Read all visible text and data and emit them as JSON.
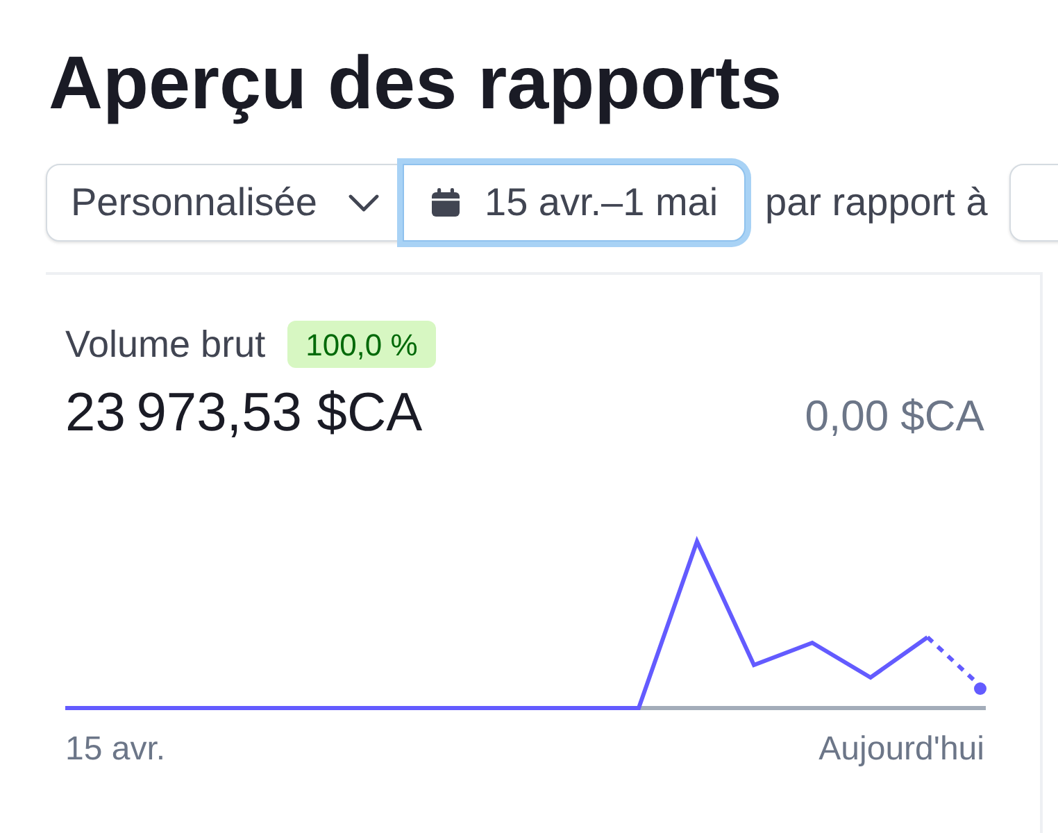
{
  "page": {
    "title": "Aperçu des rapports"
  },
  "filters": {
    "period": {
      "label": "Personnalisée"
    },
    "date_range": {
      "label": "15 avr.–1 mai",
      "focused": true
    },
    "comparison_label": "par rapport à"
  },
  "metric": {
    "title": "Volume brut",
    "change": "100,0 %",
    "value": "23 973,53 $CA",
    "previous_value": "0,00 $CA",
    "axis_start": "15 avr.",
    "axis_end": "Aujourd'hui"
  }
}
